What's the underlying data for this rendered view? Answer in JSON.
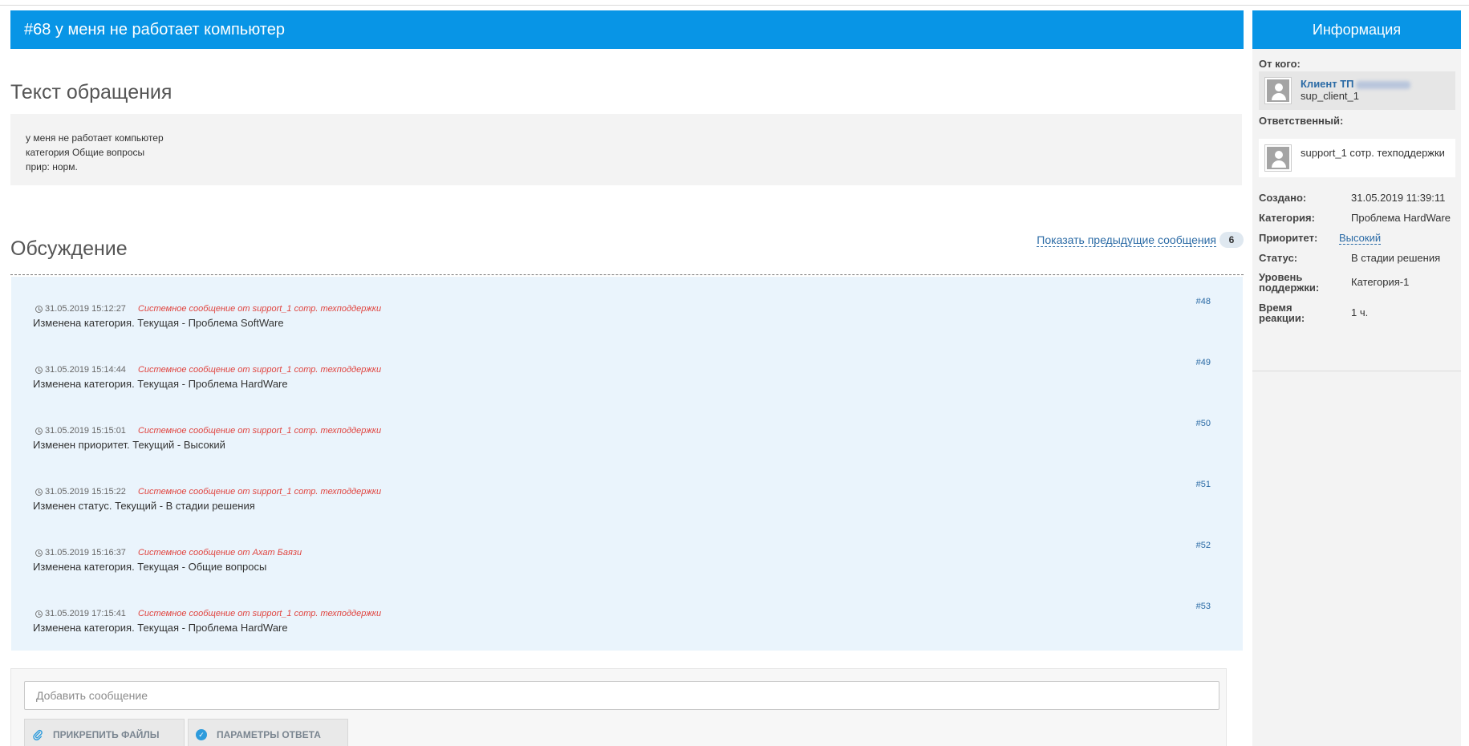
{
  "ticket": {
    "title": "#68 у меня не работает компьютер"
  },
  "request": {
    "heading": "Текст обращения",
    "lines": [
      "у меня не работает компьютер",
      "категория Общие вопросы",
      "прир: норм."
    ]
  },
  "discussion": {
    "heading": "Обсуждение",
    "show_prev_label": "Показать предыдущие сообщения",
    "show_prev_count": "6",
    "messages": [
      {
        "time": "31.05.2019 15:12:27",
        "author": "Системное сообщение от support_1 сотр. техподдержки",
        "text": "Изменена категория. Текущая - Проблема SoftWare",
        "num": "#48"
      },
      {
        "time": "31.05.2019 15:14:44",
        "author": "Системное сообщение от support_1 сотр. техподдержки",
        "text": "Изменена категория. Текущая - Проблема HardWare",
        "num": "#49"
      },
      {
        "time": "31.05.2019 15:15:01",
        "author": "Системное сообщение от support_1 сотр. техподдержки",
        "text": "Изменен приоритет. Текущий - Высокий",
        "num": "#50"
      },
      {
        "time": "31.05.2019 15:15:22",
        "author": "Системное сообщение от support_1 сотр. техподдержки",
        "text": "Изменен статус. Текущий - В стадии решения",
        "num": "#51"
      },
      {
        "time": "31.05.2019 15:16:37",
        "author": "Системное сообщение от Ахат Баязи",
        "text": "Изменена категория. Текущая - Общие вопросы",
        "num": "#52"
      },
      {
        "time": "31.05.2019 17:15:41",
        "author": "Системное сообщение от support_1 сотр. техподдержки",
        "text": "Изменена категория. Текущая - Проблема HardWare",
        "num": "#53"
      }
    ]
  },
  "compose": {
    "placeholder": "Добавить сообщение",
    "attach_label": "ПРИКРЕПИТЬ ФАЙЛЫ",
    "params_label": "ПАРАМЕТРЫ ОТВЕТА",
    "attach_icon": "paperclip-icon",
    "params_icon": "check-circle-icon"
  },
  "info": {
    "heading": "Информация",
    "from_label": "От кого:",
    "from_name": "Клиент ТП",
    "from_login": "sup_client_1",
    "responsible_label": "Ответственный:",
    "responsible_name": "support_1 сотр. техподдержки",
    "props": {
      "created_label": "Создано:",
      "created_value": "31.05.2019 11:39:11",
      "category_label": "Категория:",
      "category_value": "Проблема HardWare",
      "priority_label": "Приоритет:",
      "priority_value": "Высокий",
      "status_label": "Статус:",
      "status_value": "В стадии решения",
      "level_label_1": "Уровень",
      "level_label_2": "поддержки:",
      "level_value": "Категория-1",
      "reaction_label_1": "Время",
      "reaction_label_2": "реакции:",
      "reaction_value": "1 ч."
    }
  },
  "colors": {
    "header_blue": "#0895e6",
    "link_blue": "#2a6aa5",
    "system_red": "#e0443f",
    "messages_bg": "#eaf4fc"
  }
}
